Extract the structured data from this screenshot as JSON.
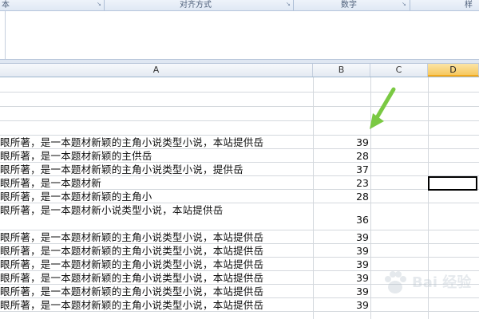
{
  "ribbon": {
    "groups": [
      "本",
      "对齐方式",
      "数字",
      "样"
    ]
  },
  "columns": [
    "A",
    "B",
    "C",
    "D"
  ],
  "selected_column": "D",
  "rows": [
    {
      "a": "",
      "b": ""
    },
    {
      "a": "",
      "b": ""
    },
    {
      "a": "",
      "b": ""
    },
    {
      "a": "",
      "b": ""
    },
    {
      "a": "眼所著，是一本题材新颖的主角小说类型小说，本站提供岳",
      "b": "39"
    },
    {
      "a": "眼所著，是一本题材新颖的主供岳",
      "b": "28"
    },
    {
      "a": "眼所著，是一本题材新颖的主角小说类型小说，提供岳",
      "b": "37"
    },
    {
      "a": "眼所著，是一本题材新",
      "b": "23"
    },
    {
      "a": "眼所著，是一本题材新颖的主角小",
      "b": "28"
    },
    {
      "a": "眼所著，是一本题材新小说类型小说，本站提供岳",
      "b": "36"
    },
    {
      "a": "眼所著，是一本题材新颖的主角小说类型小说，本站提供岳",
      "b": "39"
    },
    {
      "a": "眼所著，是一本题材新颖的主角小说类型小说，本站提供岳",
      "b": "39"
    },
    {
      "a": "眼所著，是一本题材新颖的主角小说类型小说，本站提供岳",
      "b": "39"
    },
    {
      "a": "眼所著，是一本题材新颖的主角小说类型小说，本站提供岳",
      "b": "39"
    },
    {
      "a": "眼所著，是一本题材新颖的主角小说类型小说，本站提供岳",
      "b": "39"
    },
    {
      "a": "眼所著，是一本题材新颖的主角小说类型小说，本站提供岳",
      "b": "39"
    }
  ],
  "annotation": {
    "arrow_color": "#7ac943"
  },
  "colors": {
    "selected_header": "#f6c860",
    "grid_line": "#d4d8dd"
  },
  "watermark": {
    "text": "Bai 经验"
  }
}
